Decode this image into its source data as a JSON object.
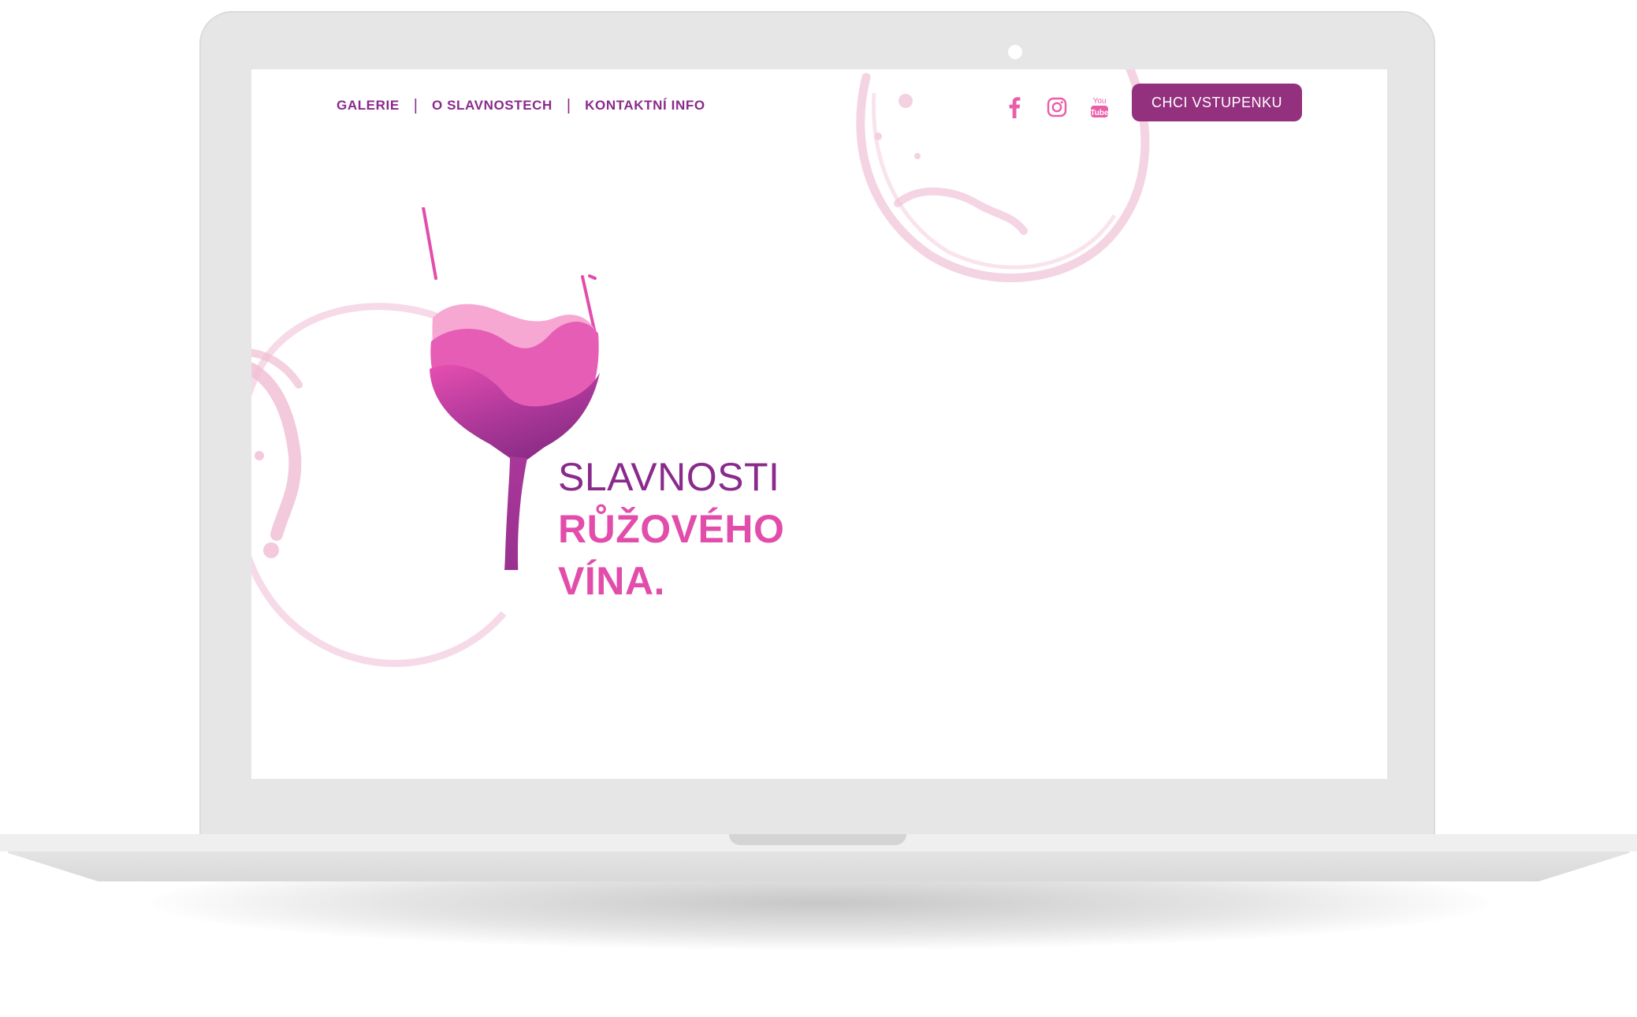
{
  "nav": {
    "items": [
      {
        "label": "GALERIE"
      },
      {
        "label": "O SLAVNOSTECH"
      },
      {
        "label": "KONTAKTNÍ INFO"
      }
    ],
    "separator": "|"
  },
  "social": {
    "facebook_icon": "facebook-icon",
    "instagram_icon": "instagram-icon",
    "youtube_icon": "youtube-icon"
  },
  "cta": {
    "label": "CHCI VSTUPENKU"
  },
  "hero": {
    "line1": "SLAVNOSTI",
    "line2": "RŮŽOVÉHO",
    "line3": "VÍNA."
  },
  "colors": {
    "brand_purple": "#8a2a8c",
    "brand_pink": "#e24dab",
    "button_bg": "#94317f",
    "stain": "#f1c6d8"
  }
}
